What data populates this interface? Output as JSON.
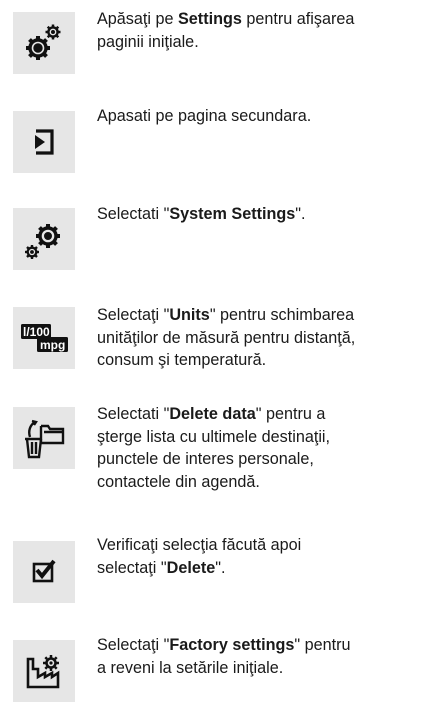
{
  "steps": [
    {
      "icon": "settings-gears-icon",
      "lines": [
        [
          {
            "t": "Apăsaţi pe "
          },
          {
            "t": "Settings",
            "b": true
          },
          {
            "t": " pentru afişarea"
          }
        ],
        [
          {
            "t": "paginii iniţiale."
          }
        ]
      ]
    },
    {
      "icon": "enter-page-icon",
      "lines": [
        [
          {
            "t": "Apasati pe pagina secundara."
          }
        ]
      ]
    },
    {
      "icon": "system-settings-icon",
      "lines": [
        [
          {
            "t": "Selectati \""
          },
          {
            "t": "System Settings",
            "b": true
          },
          {
            "t": "\"."
          }
        ]
      ]
    },
    {
      "icon": "units-icon",
      "icon_text_top": "l/100",
      "icon_text_bottom": "mpg",
      "lines": [
        [
          {
            "t": "Selectaţi \""
          },
          {
            "t": "Units",
            "b": true
          },
          {
            "t": "\" pentru schimbarea"
          }
        ],
        [
          {
            "t": "unităţilor de măsură pentru distanţă,"
          }
        ],
        [
          {
            "t": "consum şi temperatură."
          }
        ]
      ]
    },
    {
      "icon": "delete-data-icon",
      "lines": [
        [
          {
            "t": "Selectati \""
          },
          {
            "t": "Delete data",
            "b": true
          },
          {
            "t": "\" pentru a"
          }
        ],
        [
          {
            "t": "şterge lista cu ultimele destinaţii,"
          }
        ],
        [
          {
            "t": "punctele de interes personale,"
          }
        ],
        [
          {
            "t": "contactele din agendă."
          }
        ]
      ]
    },
    {
      "icon": "checkbox-confirm-icon",
      "lines": [
        [
          {
            "t": "Verificaţi selecţia făcută apoi"
          }
        ],
        [
          {
            "t": "selectaţi \""
          },
          {
            "t": "Delete",
            "b": true
          },
          {
            "t": "\"."
          }
        ]
      ]
    },
    {
      "icon": "factory-settings-icon",
      "lines": [
        [
          {
            "t": "Selectaţi \""
          },
          {
            "t": "Factory settings",
            "b": true
          },
          {
            "t": "\" pentru"
          }
        ],
        [
          {
            "t": "a reveni la setările iniţiale."
          }
        ]
      ]
    }
  ]
}
